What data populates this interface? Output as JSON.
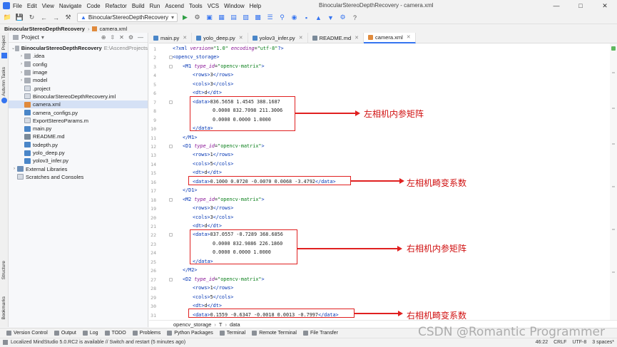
{
  "menu": {
    "items": [
      "File",
      "Edit",
      "View",
      "Navigate",
      "Code",
      "Refactor",
      "Build",
      "Run",
      "Ascend",
      "Tools",
      "VCS",
      "Window",
      "Help"
    ],
    "window_title": "BinocularStereoDepthRecovery - camera.xml"
  },
  "toolbar": {
    "run_config": "BinocularStereoDepthRecovery"
  },
  "breadcrumb": {
    "project": "BinocularStereoDepthRecovery",
    "file": "camera.xml"
  },
  "left_stripe": {
    "project_label": "Project",
    "autumn_label": "Autumn Tasks",
    "structure_label": "Structure",
    "bookmarks_label": "Bookmarks"
  },
  "project_panel": {
    "title": "Project",
    "root": {
      "name": "BinocularStereoDepthRecovery",
      "path": "E:\\AscendProjects"
    },
    "items": [
      {
        "label": ".idea",
        "type": "folder",
        "collapsed": true
      },
      {
        "label": "config",
        "type": "folder",
        "collapsed": true
      },
      {
        "label": "image",
        "type": "folder",
        "collapsed": true
      },
      {
        "label": "model",
        "type": "folder",
        "collapsed": true
      },
      {
        "label": ".project",
        "type": "file"
      },
      {
        "label": "BinocularStereoDepthRecovery.iml",
        "type": "file"
      },
      {
        "label": "camera.xml",
        "type": "xml",
        "selected": true
      },
      {
        "label": "camera_configs.py",
        "type": "py"
      },
      {
        "label": "ExportStereoParams.m",
        "type": "file"
      },
      {
        "label": "main.py",
        "type": "py"
      },
      {
        "label": "README.md",
        "type": "md"
      },
      {
        "label": "todepth.py",
        "type": "py"
      },
      {
        "label": "yolo_deep.py",
        "type": "py"
      },
      {
        "label": "yolov3_infer.py",
        "type": "py"
      }
    ],
    "external_libraries": "External Libraries",
    "scratches": "Scratches and Consoles"
  },
  "tabs": [
    {
      "label": "main.py",
      "type": "py"
    },
    {
      "label": "yolo_deep.py",
      "type": "py"
    },
    {
      "label": "yolov3_infer.py",
      "type": "py"
    },
    {
      "label": "README.md",
      "type": "md"
    },
    {
      "label": "camera.xml",
      "type": "xml",
      "active": true
    }
  ],
  "editor": {
    "lines": [
      {
        "n": "1",
        "indent": 0,
        "html": "xmldecl"
      },
      {
        "n": "2",
        "indent": 0,
        "html": "open_storage"
      },
      {
        "n": "3",
        "indent": 1,
        "name": "M1"
      },
      {
        "n": "4",
        "indent": 2,
        "text": "<rows>3</rows>"
      },
      {
        "n": "5",
        "indent": 2,
        "text": "<cols>3</cols>"
      },
      {
        "n": "6",
        "indent": 2,
        "text": "<dt>d</dt>"
      },
      {
        "n": "7",
        "indent": 2,
        "data": "836.5658 1.4545 388.1687"
      },
      {
        "n": "8",
        "indent": 2,
        "cont": "0.0000 832.7098 211.3006"
      },
      {
        "n": "9",
        "indent": 2,
        "cont": "0.0000 0.0000 1.0000"
      },
      {
        "n": "10",
        "indent": 2,
        "text": "</data>"
      },
      {
        "n": "11",
        "indent": 1,
        "text": "</M1>"
      },
      {
        "n": "12",
        "indent": 1,
        "name": "D1"
      },
      {
        "n": "13",
        "indent": 2,
        "text": "<rows>1</rows>"
      },
      {
        "n": "14",
        "indent": 2,
        "text": "<cols>5</cols>"
      },
      {
        "n": "15",
        "indent": 2,
        "text": "<dt>d</dt>"
      },
      {
        "n": "16",
        "indent": 2,
        "dataline": "0.1000 0.0720 -0.0070 0.0068 -3.4792"
      },
      {
        "n": "17",
        "indent": 1,
        "text": "</D1>"
      },
      {
        "n": "18",
        "indent": 1,
        "name": "M2"
      },
      {
        "n": "19",
        "indent": 2,
        "text": "<rows>3</rows>"
      },
      {
        "n": "20",
        "indent": 2,
        "text": "<cols>3</cols>"
      },
      {
        "n": "21",
        "indent": 2,
        "text": "<dt>d</dt>"
      },
      {
        "n": "22",
        "indent": 2,
        "data": "837.0557 -0.7289 368.6856"
      },
      {
        "n": "23",
        "indent": 2,
        "cont": "0.0000 832.9886 226.1860"
      },
      {
        "n": "24",
        "indent": 2,
        "cont": "0.0000 0.0000 1.0000"
      },
      {
        "n": "25",
        "indent": 2,
        "text": "</data>"
      },
      {
        "n": "26",
        "indent": 1,
        "text": "</M2>"
      },
      {
        "n": "27",
        "indent": 1,
        "name": "D2"
      },
      {
        "n": "28",
        "indent": 2,
        "text": "<rows>1</rows>"
      },
      {
        "n": "29",
        "indent": 2,
        "text": "<cols>5</cols>"
      },
      {
        "n": "30",
        "indent": 2,
        "text": "<dt>d</dt>"
      },
      {
        "n": "31",
        "indent": 2,
        "dataline": "0.1559 -0.6347 -0.0018 0.0013 -0.7997"
      }
    ],
    "attr_name": "type_id",
    "attr_value": "\"opencv-matrix\"",
    "xml_version": "\"1.0\"",
    "xml_encoding": "\"utf-8\""
  },
  "annotations": {
    "left_intrinsic": "左相机内参矩阵",
    "left_distortion": "左相机畸变系数",
    "right_intrinsic": "右相机内参矩阵",
    "right_distortion": "右相机畸变系数",
    "color": "#e02020"
  },
  "editor_breadcrumb": {
    "a": "opencv_storage",
    "b": "T",
    "c": "data"
  },
  "tool_windows": [
    "Version Control",
    "Output",
    "Log",
    "TODO",
    "Problems",
    "Python Packages",
    "Terminal",
    "Remote Terminal",
    "File Transfer"
  ],
  "status": {
    "message": "Localized MindStudio 5.0.RC2 is available // Switch and restart (5 minutes ago)",
    "position": "46:22",
    "line_sep": "CRLF",
    "encoding": "UTF-8",
    "indent": "3 spaces*"
  },
  "watermark": "CSDN @Romantic Programmer"
}
